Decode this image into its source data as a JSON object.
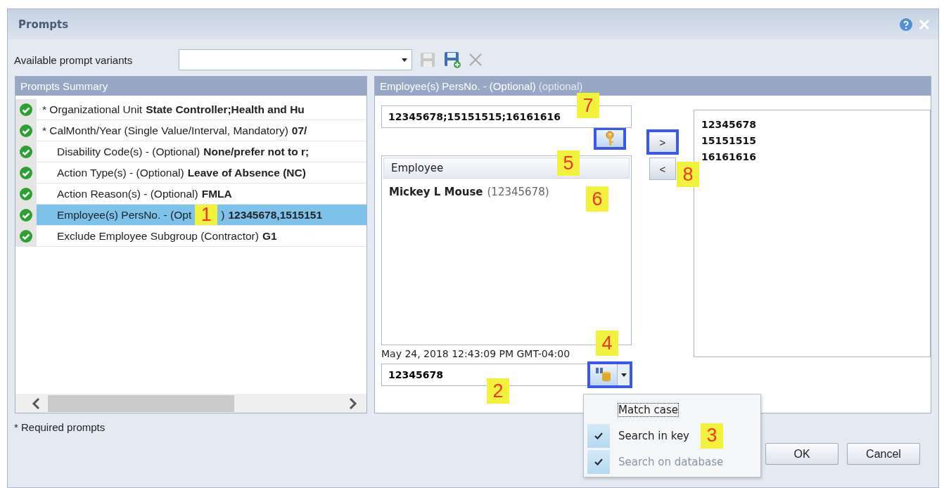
{
  "window": {
    "title": "Prompts"
  },
  "variants": {
    "label": "Available prompt variants"
  },
  "summary": {
    "title": "Prompts Summary",
    "rows": [
      {
        "label": "* Organizational Unit",
        "value": "State Controller;Health and Hu",
        "required": true,
        "selected": false
      },
      {
        "label": "* CalMonth/Year (Single Value/Interval, Mandatory)",
        "value": "07/",
        "required": true,
        "selected": false
      },
      {
        "label": "Disability Code(s) - (Optional)",
        "value": "None/prefer not to r;",
        "required": false,
        "selected": false
      },
      {
        "label": "Action Type(s) - (Optional)",
        "value": "Leave of Absence (NC)",
        "required": false,
        "selected": false
      },
      {
        "label": "Action Reason(s) - (Optional)",
        "value": "FMLA",
        "required": false,
        "selected": false
      },
      {
        "label": "Employee(s) PersNo. - (Opt",
        "callout": "1",
        "label_tail": ")",
        "value": "12345678,1515151",
        "required": false,
        "selected": true
      },
      {
        "label": "Exclude Employee Subgroup (Contractor)",
        "value": "G1",
        "required": false,
        "selected": false
      }
    ]
  },
  "detail": {
    "title": "Employee(s) PersNo. - (Optional)",
    "title_hint": "(optional)",
    "value_field": "12345678;15151515;16161616",
    "value_callout": "7",
    "key_button": {
      "highlighted": true,
      "callout": "5"
    },
    "list": {
      "column": "Employee",
      "callout": "6",
      "items": [
        {
          "name": "Mickey L Mouse",
          "key": "(12345678)"
        }
      ]
    },
    "timestamp": "May 24, 2018 12:43:09 PM GMT-04:00",
    "search": {
      "value": "12345678",
      "callout": "2",
      "button_highlighted": true,
      "button_callout": "4"
    },
    "move_buttons": [
      {
        "label": ">",
        "highlighted": true
      },
      {
        "label": "<",
        "highlighted": false
      }
    ],
    "move_callout": "8",
    "selected_values": [
      "12345678",
      "15151515",
      "16161616"
    ]
  },
  "search_menu": {
    "callout": "3",
    "items": [
      {
        "label": "Match case",
        "checked": false,
        "disabled": false
      },
      {
        "label": "Search in key",
        "checked": true,
        "disabled": false
      },
      {
        "label": "Search on database",
        "checked": true,
        "disabled": true
      }
    ]
  },
  "footnote": "* Required prompts",
  "buttons": [
    "OK",
    "Cancel"
  ]
}
